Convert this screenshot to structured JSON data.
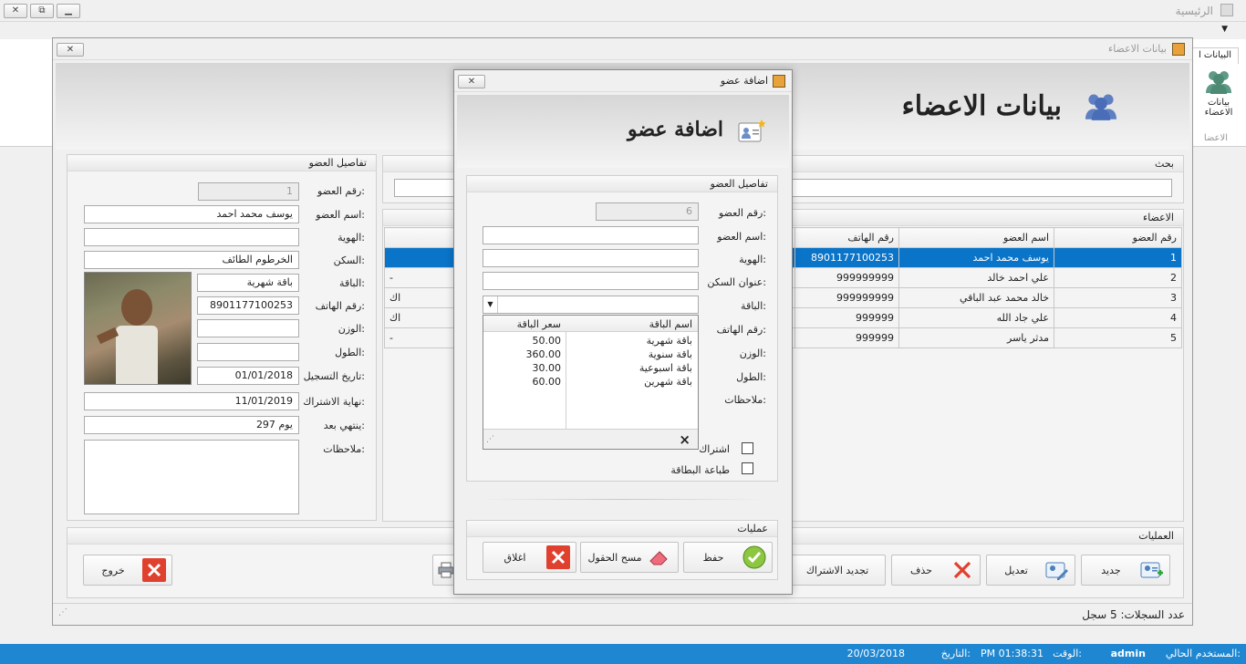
{
  "app": {
    "title": "الرئيسية",
    "ribbon_tab": "البيانات ا",
    "ribbon_btn_l1": "بيانات",
    "ribbon_btn_l2": "الاعضاء",
    "ribbon_group": "الاعضا"
  },
  "members_window": {
    "title": "بيانات الاعضاء",
    "header": "بيانات الاعضاء",
    "details": {
      "group": "تفاصيل العضو",
      "labels": {
        "id": "رقم العضو:",
        "name": "اسم العضو:",
        "identity": "الهوية:",
        "residence": "السكن:",
        "package": "الباقة:",
        "phone": "رقم الهاتف:",
        "weight": "الوزن:",
        "height": "الطول:",
        "reg_date": "تاريخ التسجيل:",
        "sub_end": "نهاية الاشتراك:",
        "ends_after": "ينتهي بعد:",
        "notes": "ملاحظات:"
      },
      "values": {
        "id": "1",
        "name": "يوسف محمد احمد",
        "identity": "",
        "residence": "الخرطوم الطائف",
        "package": "باقة شهرية",
        "phone": "8901177100253",
        "weight": "",
        "height": "",
        "reg_date": "01/01/2018",
        "sub_end": "11/01/2019",
        "ends_after": "297 يوم",
        "notes": ""
      }
    },
    "search": {
      "group": "بحث",
      "value": ""
    },
    "members_group": "الاعضاء",
    "grid": {
      "columns": [
        "رقم العضو",
        "اسم العضو",
        "رقم الهاتف"
      ],
      "rows": [
        {
          "id": "1",
          "name": "يوسف محمد احمد",
          "phone": "8901177100253",
          "extra": ""
        },
        {
          "id": "2",
          "name": "علي احمد خالد",
          "phone": "999999999",
          "extra": "-"
        },
        {
          "id": "3",
          "name": "خالد محمد عبد الباقي",
          "phone": "999999999",
          "extra": "اك"
        },
        {
          "id": "4",
          "name": "علي جاد الله",
          "phone": "999999",
          "extra": "اك"
        },
        {
          "id": "5",
          "name": "مدثر ياسر",
          "phone": "999999",
          "extra": "-"
        }
      ]
    },
    "ops": {
      "group": "العمليات",
      "new": "جديد",
      "edit": "تعديل",
      "delete": "حذف",
      "renew": "تجديد الاشتراك",
      "exit": "خروج"
    },
    "record_count": "عدد السجلات: 5 سجل"
  },
  "dialog": {
    "title": "اضافة عضو",
    "header": "اضافة عضو",
    "group": "تفاصيل العضو",
    "labels": {
      "id": "رقم العضو:",
      "name": "اسم العضو:",
      "identity": "الهوية:",
      "address": "عنوان السكن:",
      "package": "الباقة:",
      "phone": "رقم الهاتف:",
      "weight": "الوزن:",
      "height": "الطول:",
      "notes": "ملاحظات:"
    },
    "values": {
      "id": "6",
      "name": "",
      "identity": "",
      "address": "",
      "package": ""
    },
    "dropdown": {
      "columns": [
        "اسم الباقة",
        "سعر الباقة"
      ],
      "rows": [
        {
          "name": "باقة شهرية",
          "price": "50.00"
        },
        {
          "name": "باقة سنوية",
          "price": "360.00"
        },
        {
          "name": "باقة اسبوعية",
          "price": "30.00"
        },
        {
          "name": "باقة شهرين",
          "price": "60.00"
        }
      ],
      "close": "×"
    },
    "subscription_label": "اشتراك",
    "print_card_label": "طباعة البطاقة",
    "ops_group": "عمليات",
    "save": "حفظ",
    "clear": "مسح الحقول",
    "close": "اغلاق"
  },
  "status": {
    "user_label": "المستخدم الحالي:",
    "user": "admin",
    "time_label": "الوقت:",
    "time": "PM 01:38:31",
    "date_label": "التاريخ:",
    "date": "20/03/2018"
  },
  "colors": {
    "status_bar": "#1f87d1",
    "selection": "#0a74c9"
  }
}
